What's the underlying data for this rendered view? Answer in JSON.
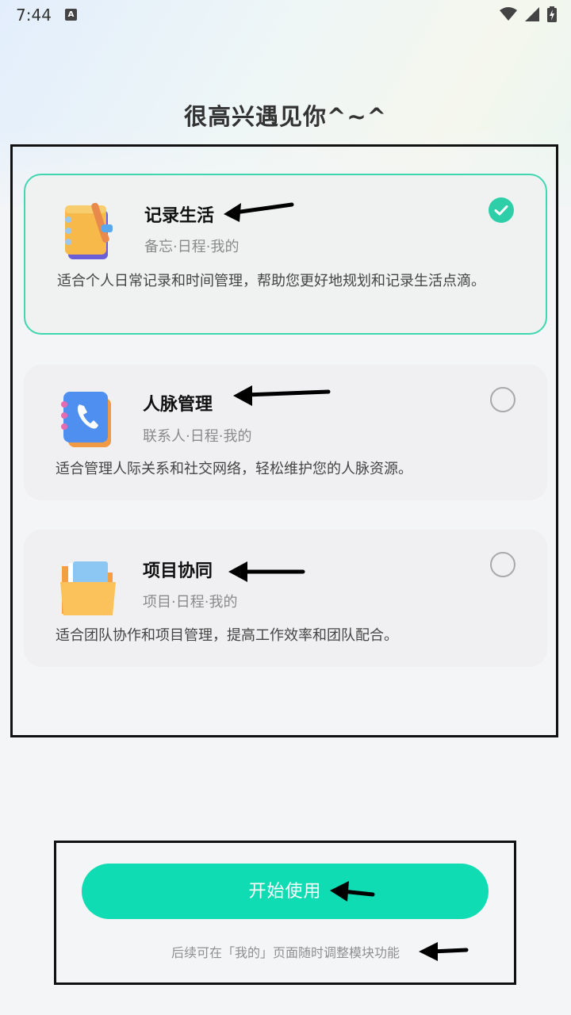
{
  "status_bar": {
    "time": "7:44",
    "notification_badge": "A",
    "icons": [
      "wifi-icon",
      "signal-icon",
      "battery-charging-icon"
    ]
  },
  "greeting": "很高兴遇见你^~^",
  "modes": [
    {
      "title": "记录生活",
      "tags": "备忘·日程·我的",
      "description": "适合个人日常记录和时间管理，帮助您更好地规划和记录生活点滴。",
      "icon": "notebook-icon",
      "selected": true
    },
    {
      "title": "人脉管理",
      "tags": "联系人·日程·我的",
      "description": "适合管理人际关系和社交网络，轻松维护您的人脉资源。",
      "icon": "phonebook-icon",
      "selected": false
    },
    {
      "title": "项目协同",
      "tags": "项目·日程·我的",
      "description": "适合团队协作和项目管理，提高工作效率和团队配合。",
      "icon": "folder-icon",
      "selected": false
    }
  ],
  "start_button": "开始使用",
  "footnote": "后续可在「我的」页面随时调整模块功能",
  "colors": {
    "accent": "#10dcb4",
    "check": "#2ecfa8",
    "selected_border": "#3fd6b0"
  }
}
